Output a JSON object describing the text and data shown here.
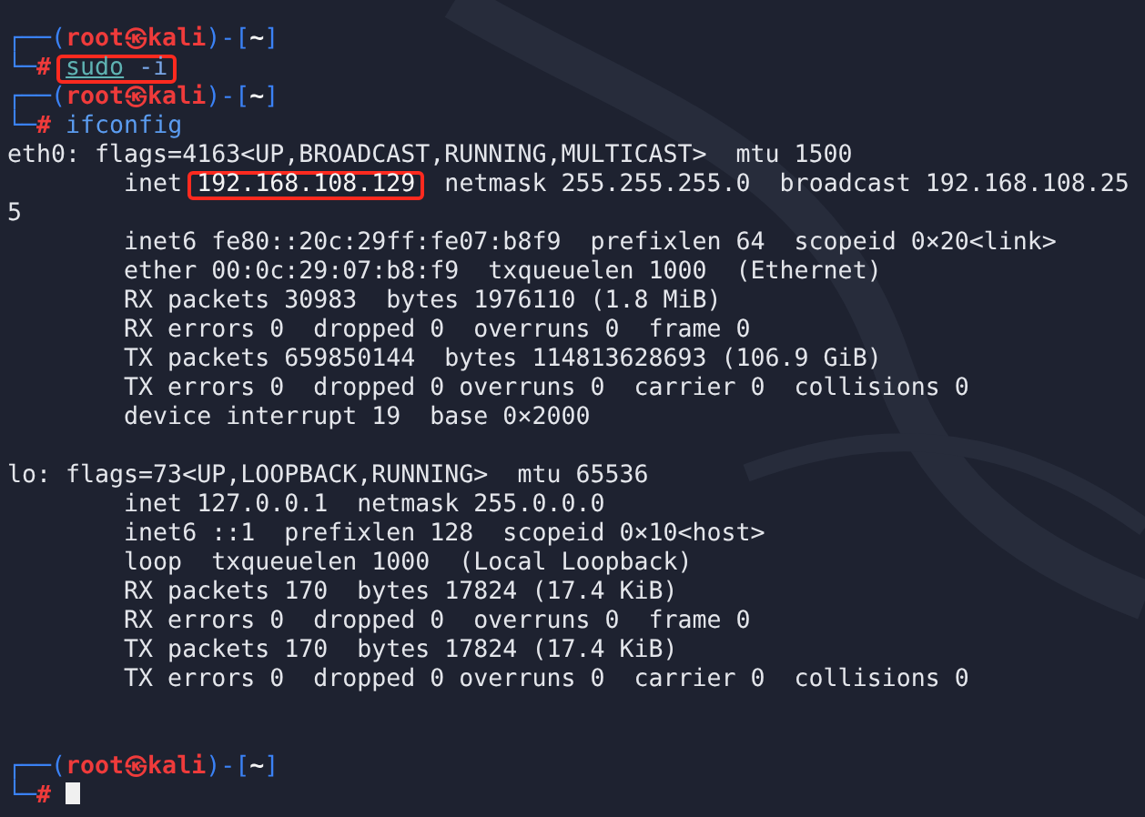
{
  "terminal": {
    "lines": [
      {
        "kind": "prompt",
        "open": "┌──(",
        "user_host": "root㉿kali",
        "mid": ")-[",
        "dir": "~",
        "close": "]",
        "corner": "└─",
        "sign": "#",
        "command": "sudo",
        "args": "-i",
        "highlighted": true,
        "cursor": false
      },
      {
        "kind": "prompt",
        "open": "┌──(",
        "user_host": "root㉿kali",
        "mid": ")-[",
        "dir": "~",
        "close": "]",
        "corner": "└─",
        "sign": "#",
        "command": "ifconfig",
        "highlighted": false,
        "cursor": false
      },
      {
        "kind": "output",
        "text": "eth0: flags=4163<UP,BROADCAST,RUNNING,MULTICAST>  mtu 1500"
      },
      {
        "kind": "output",
        "before": "        inet ",
        "highlight": "192.168.108.129",
        "after": "  netmask 255.255.255.0  broadcast 192.168.108.25"
      },
      {
        "kind": "output",
        "text": "5"
      },
      {
        "kind": "output",
        "text": "        inet6 fe80::20c:29ff:fe07:b8f9  prefixlen 64  scopeid 0×20<link>"
      },
      {
        "kind": "output",
        "text": "        ether 00:0c:29:07:b8:f9  txqueuelen 1000  (Ethernet)"
      },
      {
        "kind": "output",
        "text": "        RX packets 30983  bytes 1976110 (1.8 MiB)"
      },
      {
        "kind": "output",
        "text": "        RX errors 0  dropped 0  overruns 0  frame 0"
      },
      {
        "kind": "output",
        "text": "        TX packets 659850144  bytes 114813628693 (106.9 GiB)"
      },
      {
        "kind": "output",
        "text": "        TX errors 0  dropped 0 overruns 0  carrier 0  collisions 0"
      },
      {
        "kind": "output",
        "text": "        device interrupt 19  base 0×2000"
      },
      {
        "kind": "blank"
      },
      {
        "kind": "output",
        "text": "lo: flags=73<UP,LOOPBACK,RUNNING>  mtu 65536"
      },
      {
        "kind": "output",
        "text": "        inet 127.0.0.1  netmask 255.0.0.0"
      },
      {
        "kind": "output",
        "text": "        inet6 ::1  prefixlen 128  scopeid 0×10<host>"
      },
      {
        "kind": "output",
        "text": "        loop  txqueuelen 1000  (Local Loopback)"
      },
      {
        "kind": "output",
        "text": "        RX packets 170  bytes 17824 (17.4 KiB)"
      },
      {
        "kind": "output",
        "text": "        RX errors 0  dropped 0  overruns 0  frame 0"
      },
      {
        "kind": "output",
        "text": "        TX packets 170  bytes 17824 (17.4 KiB)"
      },
      {
        "kind": "output",
        "text": "        TX errors 0  dropped 0 overruns 0  carrier 0  collisions 0"
      },
      {
        "kind": "blank"
      },
      {
        "kind": "blank"
      },
      {
        "kind": "prompt",
        "open": "┌──(",
        "user_host": "root㉿kali",
        "mid": ")-[",
        "dir": "~",
        "close": "]",
        "corner": "└─",
        "sign": "#",
        "highlighted": false,
        "cursor": true
      }
    ]
  }
}
